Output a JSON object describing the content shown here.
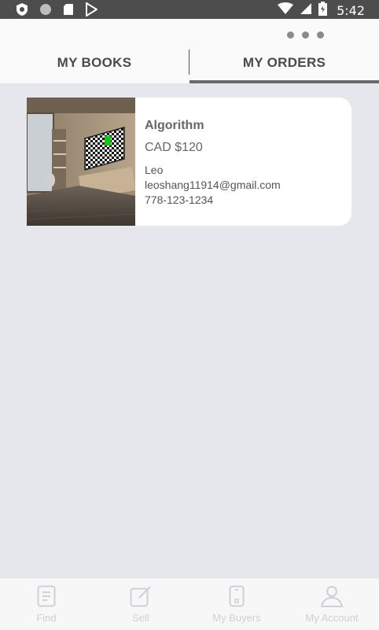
{
  "status_bar": {
    "time": "5:42",
    "left_icons": [
      "shield-icon",
      "circle-icon",
      "sd-card-icon",
      "play-store-icon"
    ],
    "right_icons": [
      "wifi-icon",
      "signal-icon",
      "battery-icon"
    ]
  },
  "header": {
    "overflow_icon": "more-horizontal-icon",
    "tabs": [
      {
        "label": "MY BOOKS",
        "selected": false
      },
      {
        "label": "MY ORDERS",
        "selected": true
      }
    ]
  },
  "orders": [
    {
      "title": "Algorithm",
      "price": "CAD $120",
      "seller": "Leo",
      "email": "leoshang11914@gmail.com",
      "phone": "778-123-1234",
      "image": "room-photo-with-tv"
    }
  ],
  "bottom_nav": {
    "items": [
      {
        "label": "Find",
        "icon": "document-icon"
      },
      {
        "label": "Sell",
        "icon": "edit-icon"
      },
      {
        "label": "My Buyers",
        "icon": "phone-icon"
      },
      {
        "label": "My Account",
        "icon": "person-icon"
      }
    ]
  },
  "colors": {
    "status_bar": "#4d4d4d",
    "background": "#e6e7ec",
    "tab_text": "#4a4a4a",
    "nav_inactive": "#cfd0d6"
  }
}
